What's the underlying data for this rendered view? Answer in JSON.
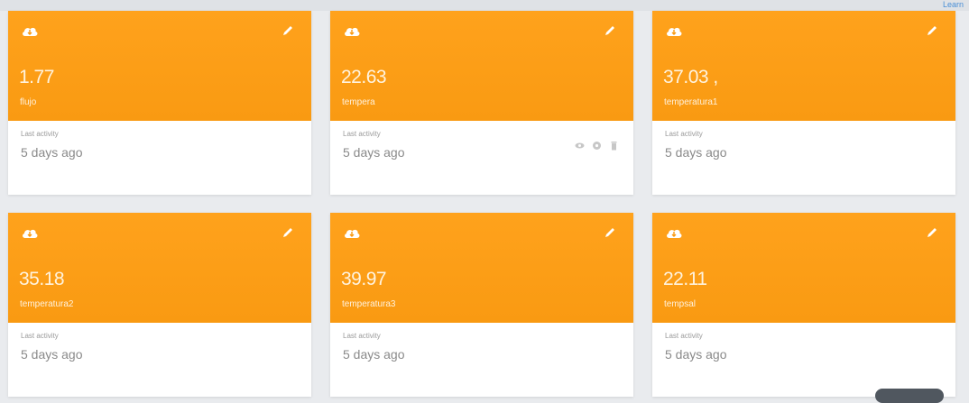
{
  "header": {
    "corner_link": "Learn"
  },
  "cards": [
    {
      "value": "1.77",
      "variable": "flujo",
      "activity_label": "Last activity",
      "activity_value": "5 days ago",
      "icon": "cloud-icon",
      "show_actions": false
    },
    {
      "value": "22.63",
      "variable": "tempera",
      "activity_label": "Last activity",
      "activity_value": "5 days ago",
      "icon": "cloud-icon",
      "show_actions": true
    },
    {
      "value": "37.03 ,",
      "variable": "temperatura1",
      "activity_label": "Last activity",
      "activity_value": "5 days ago",
      "icon": "cloud-icon",
      "show_actions": false
    },
    {
      "value": "35.18",
      "variable": "temperatura2",
      "activity_label": "Last activity",
      "activity_value": "5 days ago",
      "icon": "cloud-icon",
      "show_actions": false
    },
    {
      "value": "39.97",
      "variable": "temperatura3",
      "activity_label": "Last activity",
      "activity_value": "5 days ago",
      "icon": "cloud-icon",
      "show_actions": false
    },
    {
      "value": "22.11",
      "variable": "tempsal",
      "activity_label": "Last activity",
      "activity_value": "5 days ago",
      "icon": "cloud-icon",
      "show_actions": false
    }
  ],
  "colors": {
    "card_header": "#f99a12",
    "page_background": "#e9ebee",
    "activity_text": "#8a8a8a"
  }
}
